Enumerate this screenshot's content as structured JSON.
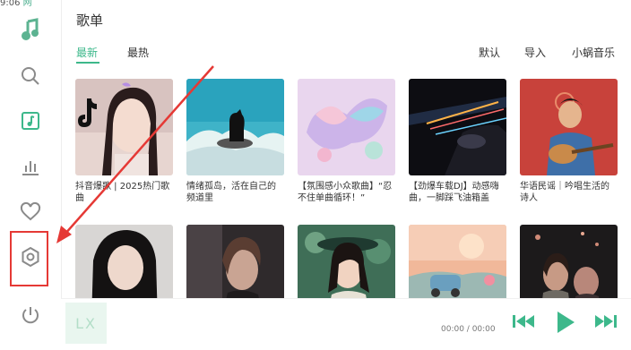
{
  "status_bar": {
    "time": "9:06",
    "app": "网"
  },
  "sidebar": {
    "items": [
      {
        "icon": "music-note-icon"
      },
      {
        "icon": "search-icon"
      },
      {
        "icon": "playlist-music-icon"
      },
      {
        "icon": "chart-bars-icon"
      },
      {
        "icon": "heart-icon"
      },
      {
        "icon": "settings-hexagon-icon"
      },
      {
        "icon": "power-icon"
      }
    ]
  },
  "header": {
    "title": "歌单"
  },
  "tabs": [
    {
      "label": "最新"
    },
    {
      "label": "最热"
    }
  ],
  "actions": [
    {
      "label": "默认"
    },
    {
      "label": "导入"
    },
    {
      "label": "小蜗音乐"
    }
  ],
  "playlists": [
    {
      "name": "抖音爆歌 | 2025热门歌曲"
    },
    {
      "name": "情绪孤岛，活在自己的频道里"
    },
    {
      "name": "【氛围感小众歌曲】“忍不住单曲循环！”"
    },
    {
      "name": "【劲爆车载DJ】动感嗨曲，一脚踩飞油箱盖"
    },
    {
      "name": "华语民谣｜吟唱生活的诗人"
    },
    {
      "name": ""
    },
    {
      "name": ""
    },
    {
      "name": ""
    },
    {
      "name": ""
    },
    {
      "name": ""
    }
  ],
  "player": {
    "logo": "LX",
    "time": "00:00 / 00:00"
  },
  "colors": {
    "accent": "#3db88b",
    "annotation": "#e53935"
  }
}
